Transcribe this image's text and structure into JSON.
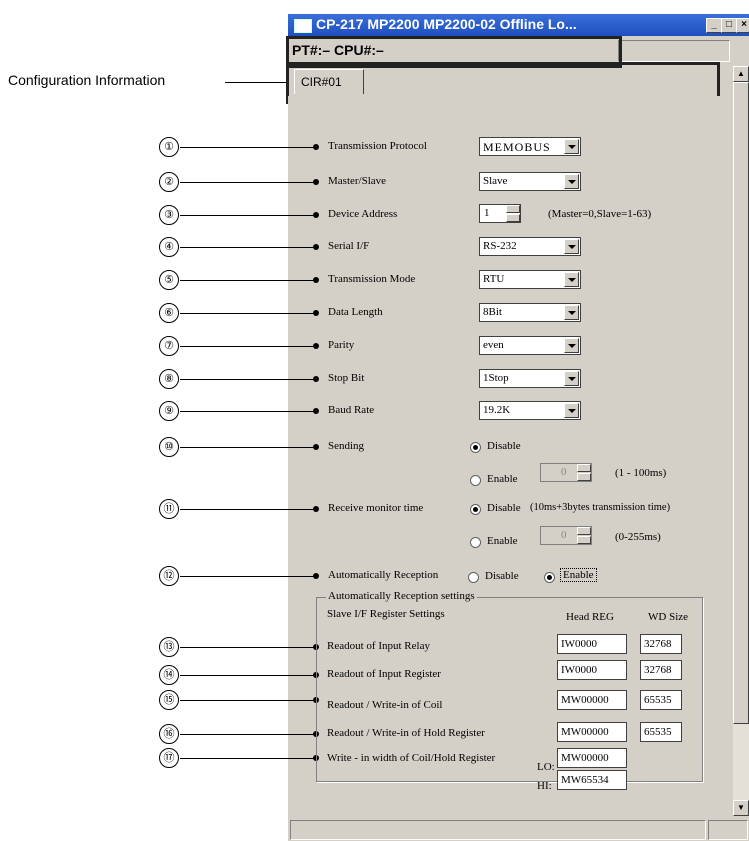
{
  "annotation": {
    "config_label": "Configuration Information"
  },
  "window": {
    "title": "CP-217   MP2200    MP2200-02 Offline  Lo...",
    "pt_cpu": "PT#:– CPU#:–",
    "tab": "CIR#01",
    "controls": {
      "minimize": "_",
      "maximize": "□",
      "close": "×"
    }
  },
  "callouts": [
    "①",
    "②",
    "③",
    "④",
    "⑤",
    "⑥",
    "⑦",
    "⑧",
    "⑨",
    "⑩",
    "⑪",
    "⑫",
    "⑬",
    "⑭",
    "⑮",
    "⑯",
    "⑰"
  ],
  "settings": {
    "transmission_protocol": {
      "label": "Transmission Protocol",
      "value": "MEMOBUS"
    },
    "master_slave": {
      "label": "Master/Slave",
      "value": "Slave"
    },
    "device_address": {
      "label": "Device Address",
      "value": "1",
      "hint": "(Master=0,Slave=1-63)"
    },
    "serial_if": {
      "label": "Serial I/F",
      "value": "RS-232"
    },
    "transmission_mode": {
      "label": "Transmission Mode",
      "value": "RTU"
    },
    "data_length": {
      "label": "Data Length",
      "value": "8Bit"
    },
    "parity": {
      "label": "Parity",
      "value": "even"
    },
    "stop_bit": {
      "label": "Stop Bit",
      "value": "1Stop"
    },
    "baud_rate": {
      "label": "Baud Rate",
      "value": "19.2K"
    },
    "sending": {
      "label": "Sending",
      "disable": "Disable",
      "enable": "Enable",
      "value": "0",
      "range": "(1 - 100ms)",
      "selected": "Disable"
    },
    "receive_monitor": {
      "label": "Receive monitor time",
      "disable": "Disable",
      "disable_note": "(10ms+3bytes transmission time)",
      "enable": "Enable",
      "value": "0",
      "range": "(0-255ms)",
      "selected": "Disable"
    },
    "auto_reception": {
      "label": "Automatically Reception",
      "disable": "Disable",
      "enable": "Enable",
      "selected": "Enable"
    }
  },
  "register_group": {
    "title": "Automatically Reception settings",
    "subtitle": "Slave I/F Register Settings",
    "col_head": "Head REG",
    "col_size": "WD Size",
    "rows": [
      {
        "label": "Readout of Input Relay",
        "head": "IW0000",
        "size": "32768"
      },
      {
        "label": "Readout of Input Register",
        "head": "IW0000",
        "size": "32768"
      },
      {
        "label": "Readout / Write-in of Coil",
        "head": "MW00000",
        "size": "65535"
      },
      {
        "label": "Readout / Write-in of Hold Register",
        "head": "MW00000",
        "size": "65535"
      }
    ],
    "write_width": {
      "label": "Write - in width of Coil/Hold Register",
      "lo_label": "LO:",
      "lo": "MW00000",
      "hi_label": "HI:",
      "hi": "MW65534"
    }
  }
}
